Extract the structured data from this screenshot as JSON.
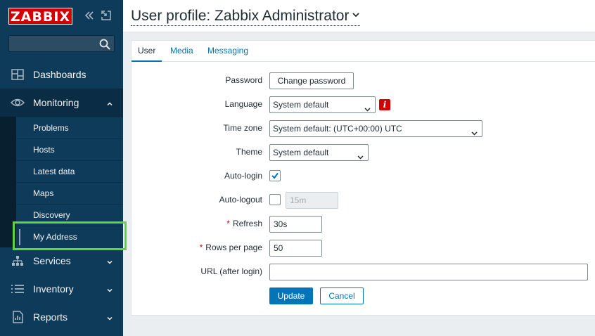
{
  "sidebar": {
    "logo": "ZABBIX",
    "search_placeholder": "",
    "nav": {
      "dashboards": "Dashboards",
      "monitoring": "Monitoring",
      "services": "Services",
      "inventory": "Inventory",
      "reports": "Reports"
    },
    "monitoring_sub": {
      "problems": "Problems",
      "hosts": "Hosts",
      "latest_data": "Latest data",
      "maps": "Maps",
      "discovery": "Discovery",
      "my_address": "My Address"
    }
  },
  "header": {
    "title": "User profile: Zabbix Administrator"
  },
  "tabs": {
    "user": "User",
    "media": "Media",
    "messaging": "Messaging"
  },
  "form": {
    "password_label": "Password",
    "change_password_button": "Change password",
    "language_label": "Language",
    "language_value": "System default",
    "timezone_label": "Time zone",
    "timezone_value": "System default: (UTC+00:00) UTC",
    "theme_label": "Theme",
    "theme_value": "System default",
    "autologin_label": "Auto-login",
    "autologin_checked": true,
    "autologout_label": "Auto-logout",
    "autologout_checked": false,
    "autologout_value": "15m",
    "refresh_label": "Refresh",
    "refresh_value": "30s",
    "rows_label": "Rows per page",
    "rows_value": "50",
    "url_label": "URL (after login)",
    "url_value": "",
    "required_mark": "*",
    "info_glyph": "i"
  },
  "actions": {
    "update": "Update",
    "cancel": "Cancel"
  },
  "colors": {
    "sidebar_bg": "#0e3b5a",
    "accent": "#0275b8",
    "logo_red": "#d40000",
    "highlight_green": "#59d83c"
  },
  "icons": {
    "collapse": "double-chevron-left-icon",
    "kiosk": "fullscreen-icon",
    "search": "search-icon",
    "dashboards": "dashboard-icon",
    "monitoring": "eye-icon",
    "services": "hierarchy-icon",
    "inventory": "list-icon",
    "reports": "report-icon"
  }
}
